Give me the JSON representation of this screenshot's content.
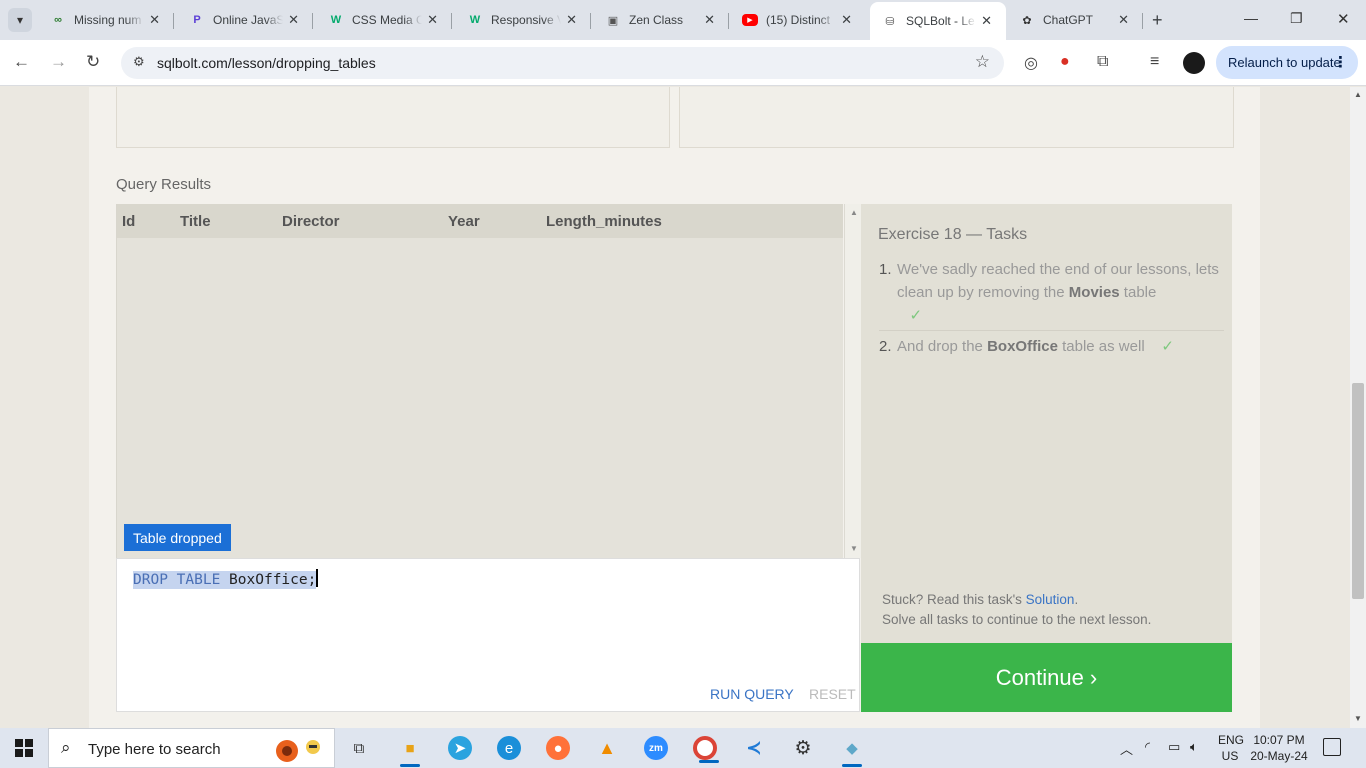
{
  "browser": {
    "tabs": [
      {
        "label": "Missing num",
        "icon": "link-icon"
      },
      {
        "label": "Online JavaS",
        "icon": "editor-icon"
      },
      {
        "label": "CSS Media C",
        "icon": "w3schools-icon"
      },
      {
        "label": "Responsive V",
        "icon": "w3schools-icon"
      },
      {
        "label": "Zen Class",
        "icon": "zen-class-icon"
      },
      {
        "label": "(15) Distinct",
        "icon": "youtube-icon"
      },
      {
        "label": "SQLBolt - Le",
        "icon": "database-icon",
        "active": true
      },
      {
        "label": "ChatGPT",
        "icon": "chatgpt-icon"
      }
    ],
    "url": "sqlbolt.com/lesson/dropping_tables",
    "relaunch_label": "Relaunch to update"
  },
  "lesson": {
    "query_results_label": "Query Results",
    "columns": [
      "Id",
      "Title",
      "Director",
      "Year",
      "Length_minutes"
    ],
    "status_badge": "Table dropped",
    "query": {
      "keyword": "DROP TABLE",
      "table": "BoxOffice;"
    },
    "run_label": "RUN QUERY",
    "reset_label": "RESET"
  },
  "exercise": {
    "title": "Exercise 18 — Tasks",
    "tasks": [
      {
        "number": "1.",
        "before": "We've sadly reached the end of our lessons, lets clean up by removing the ",
        "bold": "Movies",
        "after": " table",
        "check": "✓"
      },
      {
        "number": "2.",
        "before": "And drop the ",
        "bold": "BoxOffice",
        "after": " table as well",
        "check": "✓"
      }
    ],
    "stuck_prefix": "Stuck? Read this task's ",
    "stuck_link": "Solution",
    "stuck_suffix": ".",
    "solve_note": "Solve all tasks to continue to the next lesson.",
    "continue_label": "Continue ›"
  },
  "taskbar": {
    "search_placeholder": "Type here to search",
    "lang_line1": "ENG",
    "lang_line2": "US",
    "time": "10:07 PM",
    "date": "20-May-24"
  },
  "colors": {
    "continue_green": "#3bb54a",
    "badge_blue": "#1b6fd6",
    "link_blue": "#3a74c5",
    "check_green": "#7ec87e"
  }
}
